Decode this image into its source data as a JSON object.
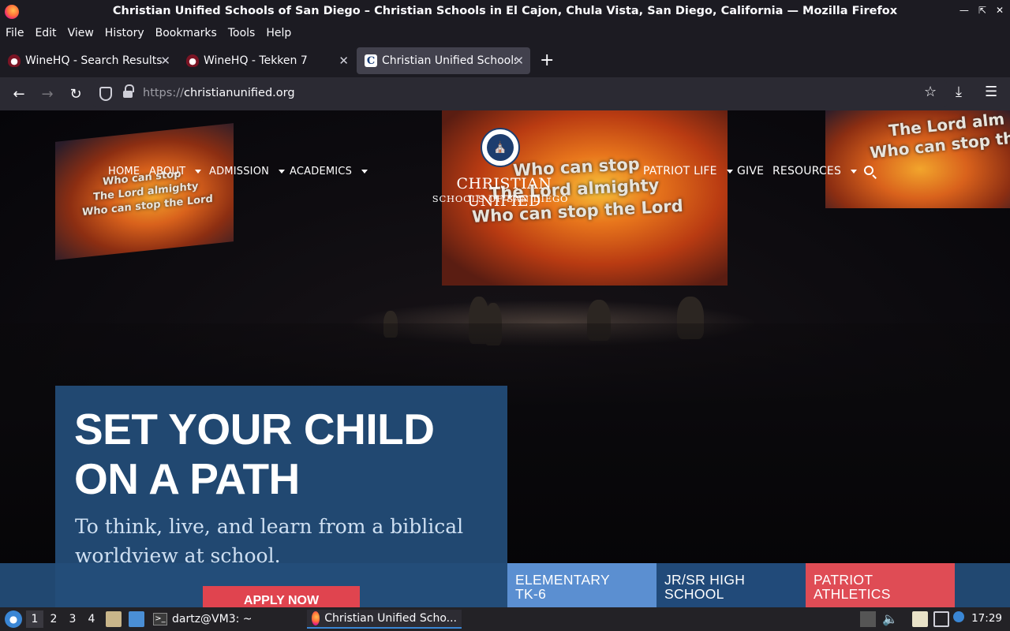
{
  "window": {
    "title": "Christian Unified Schools of San Diego – Christian Schools in El Cajon, Chula Vista, San Diego, California — Mozilla Firefox"
  },
  "menu": [
    "File",
    "Edit",
    "View",
    "History",
    "Bookmarks",
    "Tools",
    "Help"
  ],
  "tabs": [
    {
      "label": "WineHQ - Search Results",
      "favicon": "winehq-icon",
      "active": false
    },
    {
      "label": "WineHQ - Tekken 7",
      "favicon": "winehq-icon",
      "active": false
    },
    {
      "label": "Christian Unified Schools",
      "favicon": "cus-icon",
      "active": true
    }
  ],
  "address": {
    "protocol": "https://",
    "host": "christianunified.org"
  },
  "site": {
    "nav_left": [
      "HOME",
      "ABOUT",
      "ADMISSION",
      "ACADEMICS"
    ],
    "nav_right": [
      "PATRIOT LIFE",
      "GIVE",
      "RESOURCES"
    ],
    "logo_main": "CHRISTIAN UNIFIED",
    "logo_sub": "SCHOOLS OF SAN DIEGO",
    "lyrics": {
      "left": [
        "Who can stop",
        "The Lord almighty",
        "Who can stop the Lord"
      ],
      "center": [
        "Who can stop",
        "The Lord almighty",
        "Who can stop the Lord"
      ],
      "right": [
        "The Lord alm",
        "Who can stop th"
      ]
    },
    "hero_title_line1": "SET YOUR CHILD",
    "hero_title_line2": "ON A PATH",
    "hero_sub_line1": "To think, live, and learn from a biblical",
    "hero_sub_line2": "worldview at school.",
    "apply_label": "APPLY NOW",
    "tiles": [
      {
        "line1": "ELEMENTARY",
        "line2": "TK-6"
      },
      {
        "line1": "JR/SR HIGH",
        "line2": "SCHOOL"
      },
      {
        "line1": "PATRIOT",
        "line2": "ATHLETICS"
      }
    ]
  },
  "taskbar": {
    "workspaces": [
      "1",
      "2",
      "3",
      "4"
    ],
    "terminal_label": "dartz@VM3: ~",
    "firefox_label": "Christian Unified Scho...",
    "clock": "17:29"
  },
  "colors": {
    "card_blue": "#244e7a",
    "tile_elementary": "#5b8fd1",
    "tile_jrsr": "#214a79",
    "tile_athletics": "#df4c55",
    "apply_red": "#e0444f"
  }
}
